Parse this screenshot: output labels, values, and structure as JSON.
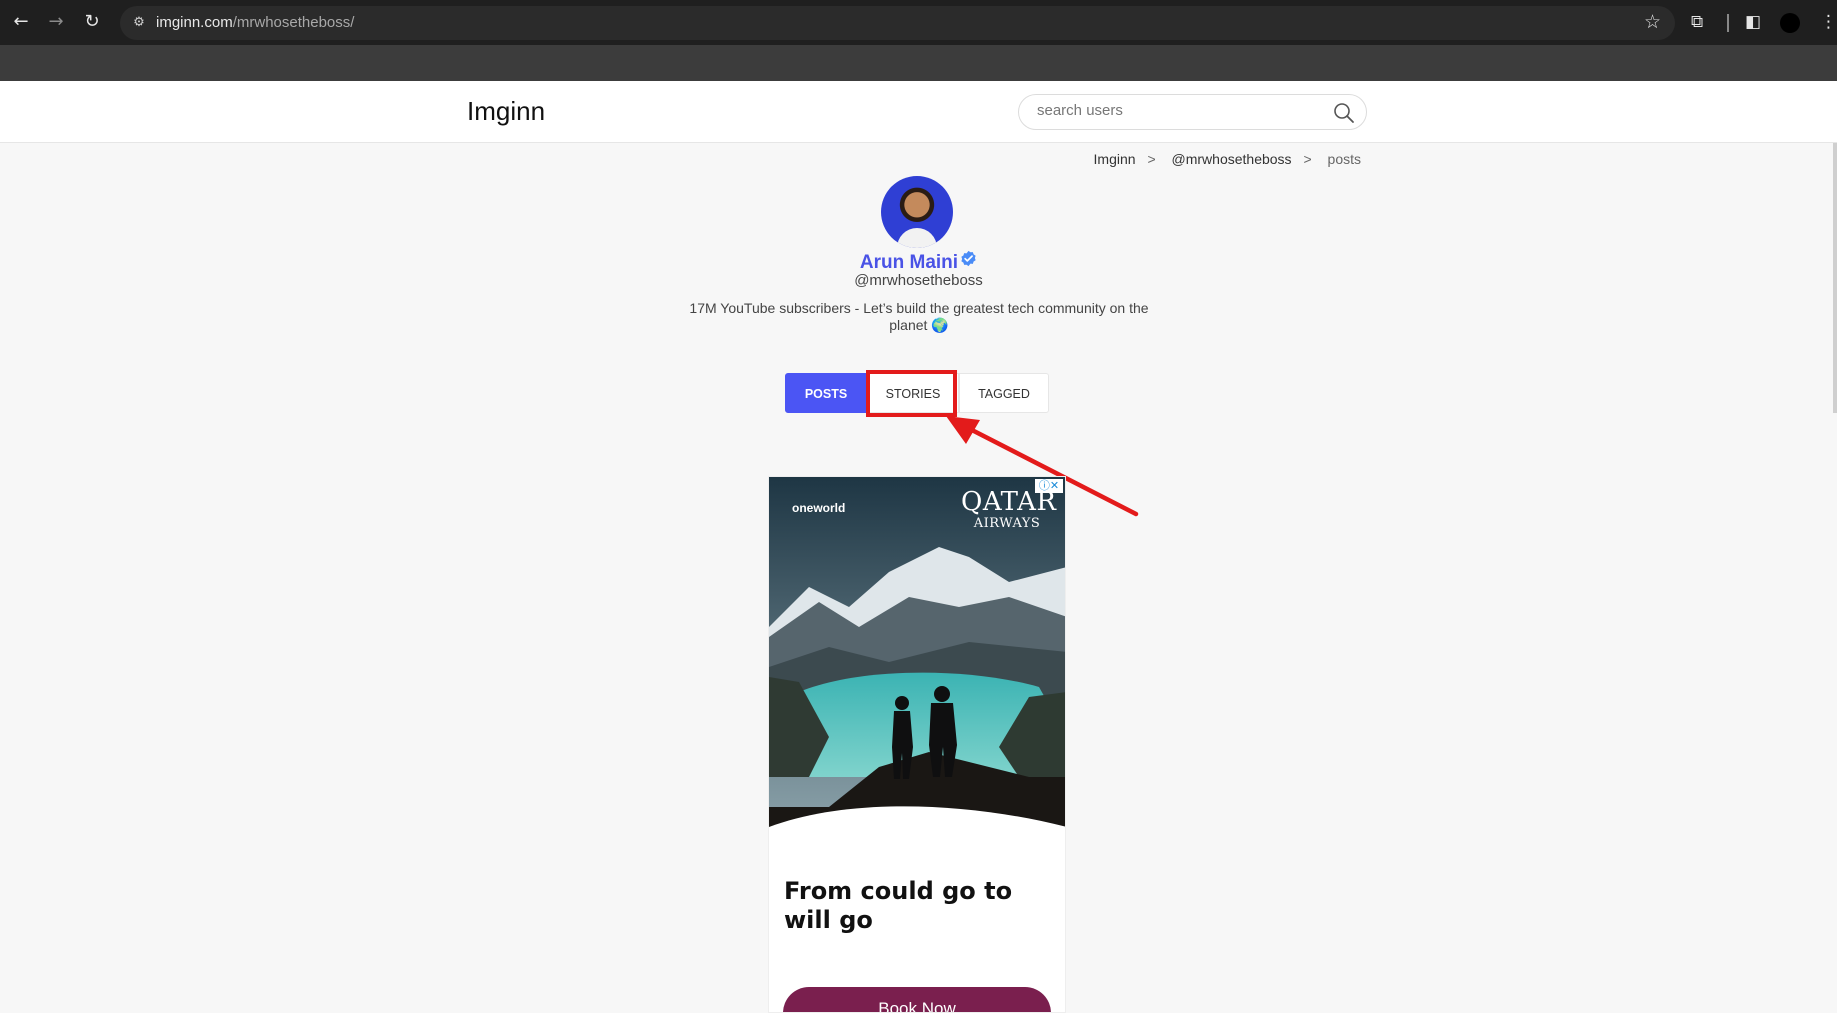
{
  "browser": {
    "url_host": "imginn.com",
    "url_path": "/mrwhosetheboss/",
    "back_icon": "arrow-left-icon",
    "forward_icon": "arrow-right-icon",
    "reload_icon": "reload-icon",
    "bookmark_icon": "star-icon"
  },
  "site": {
    "logo": "Imginn",
    "search_placeholder": "search users"
  },
  "breadcrumb": {
    "items": [
      "Imginn",
      "@mrwhosetheboss",
      "posts"
    ],
    "separator": ">"
  },
  "profile": {
    "name": "Arun Maini",
    "handle": "@mrwhosetheboss",
    "bio": "17M YouTube subscribers - Let’s build the greatest tech community on the planet 🌍",
    "verified": true
  },
  "tabs": [
    {
      "label": "POSTS",
      "active": true
    },
    {
      "label": "STORIES",
      "active": false
    },
    {
      "label": "TAGGED",
      "active": false
    }
  ],
  "ad": {
    "brand": "oneworld",
    "logo_main": "QATAR",
    "logo_sub": "AIRWAYS",
    "headline": "From could go to will go",
    "cta": "Book Now"
  },
  "colors": {
    "accent": "#4b55f4",
    "annotation": "#e31b1b",
    "cta": "#7a1f4e"
  }
}
